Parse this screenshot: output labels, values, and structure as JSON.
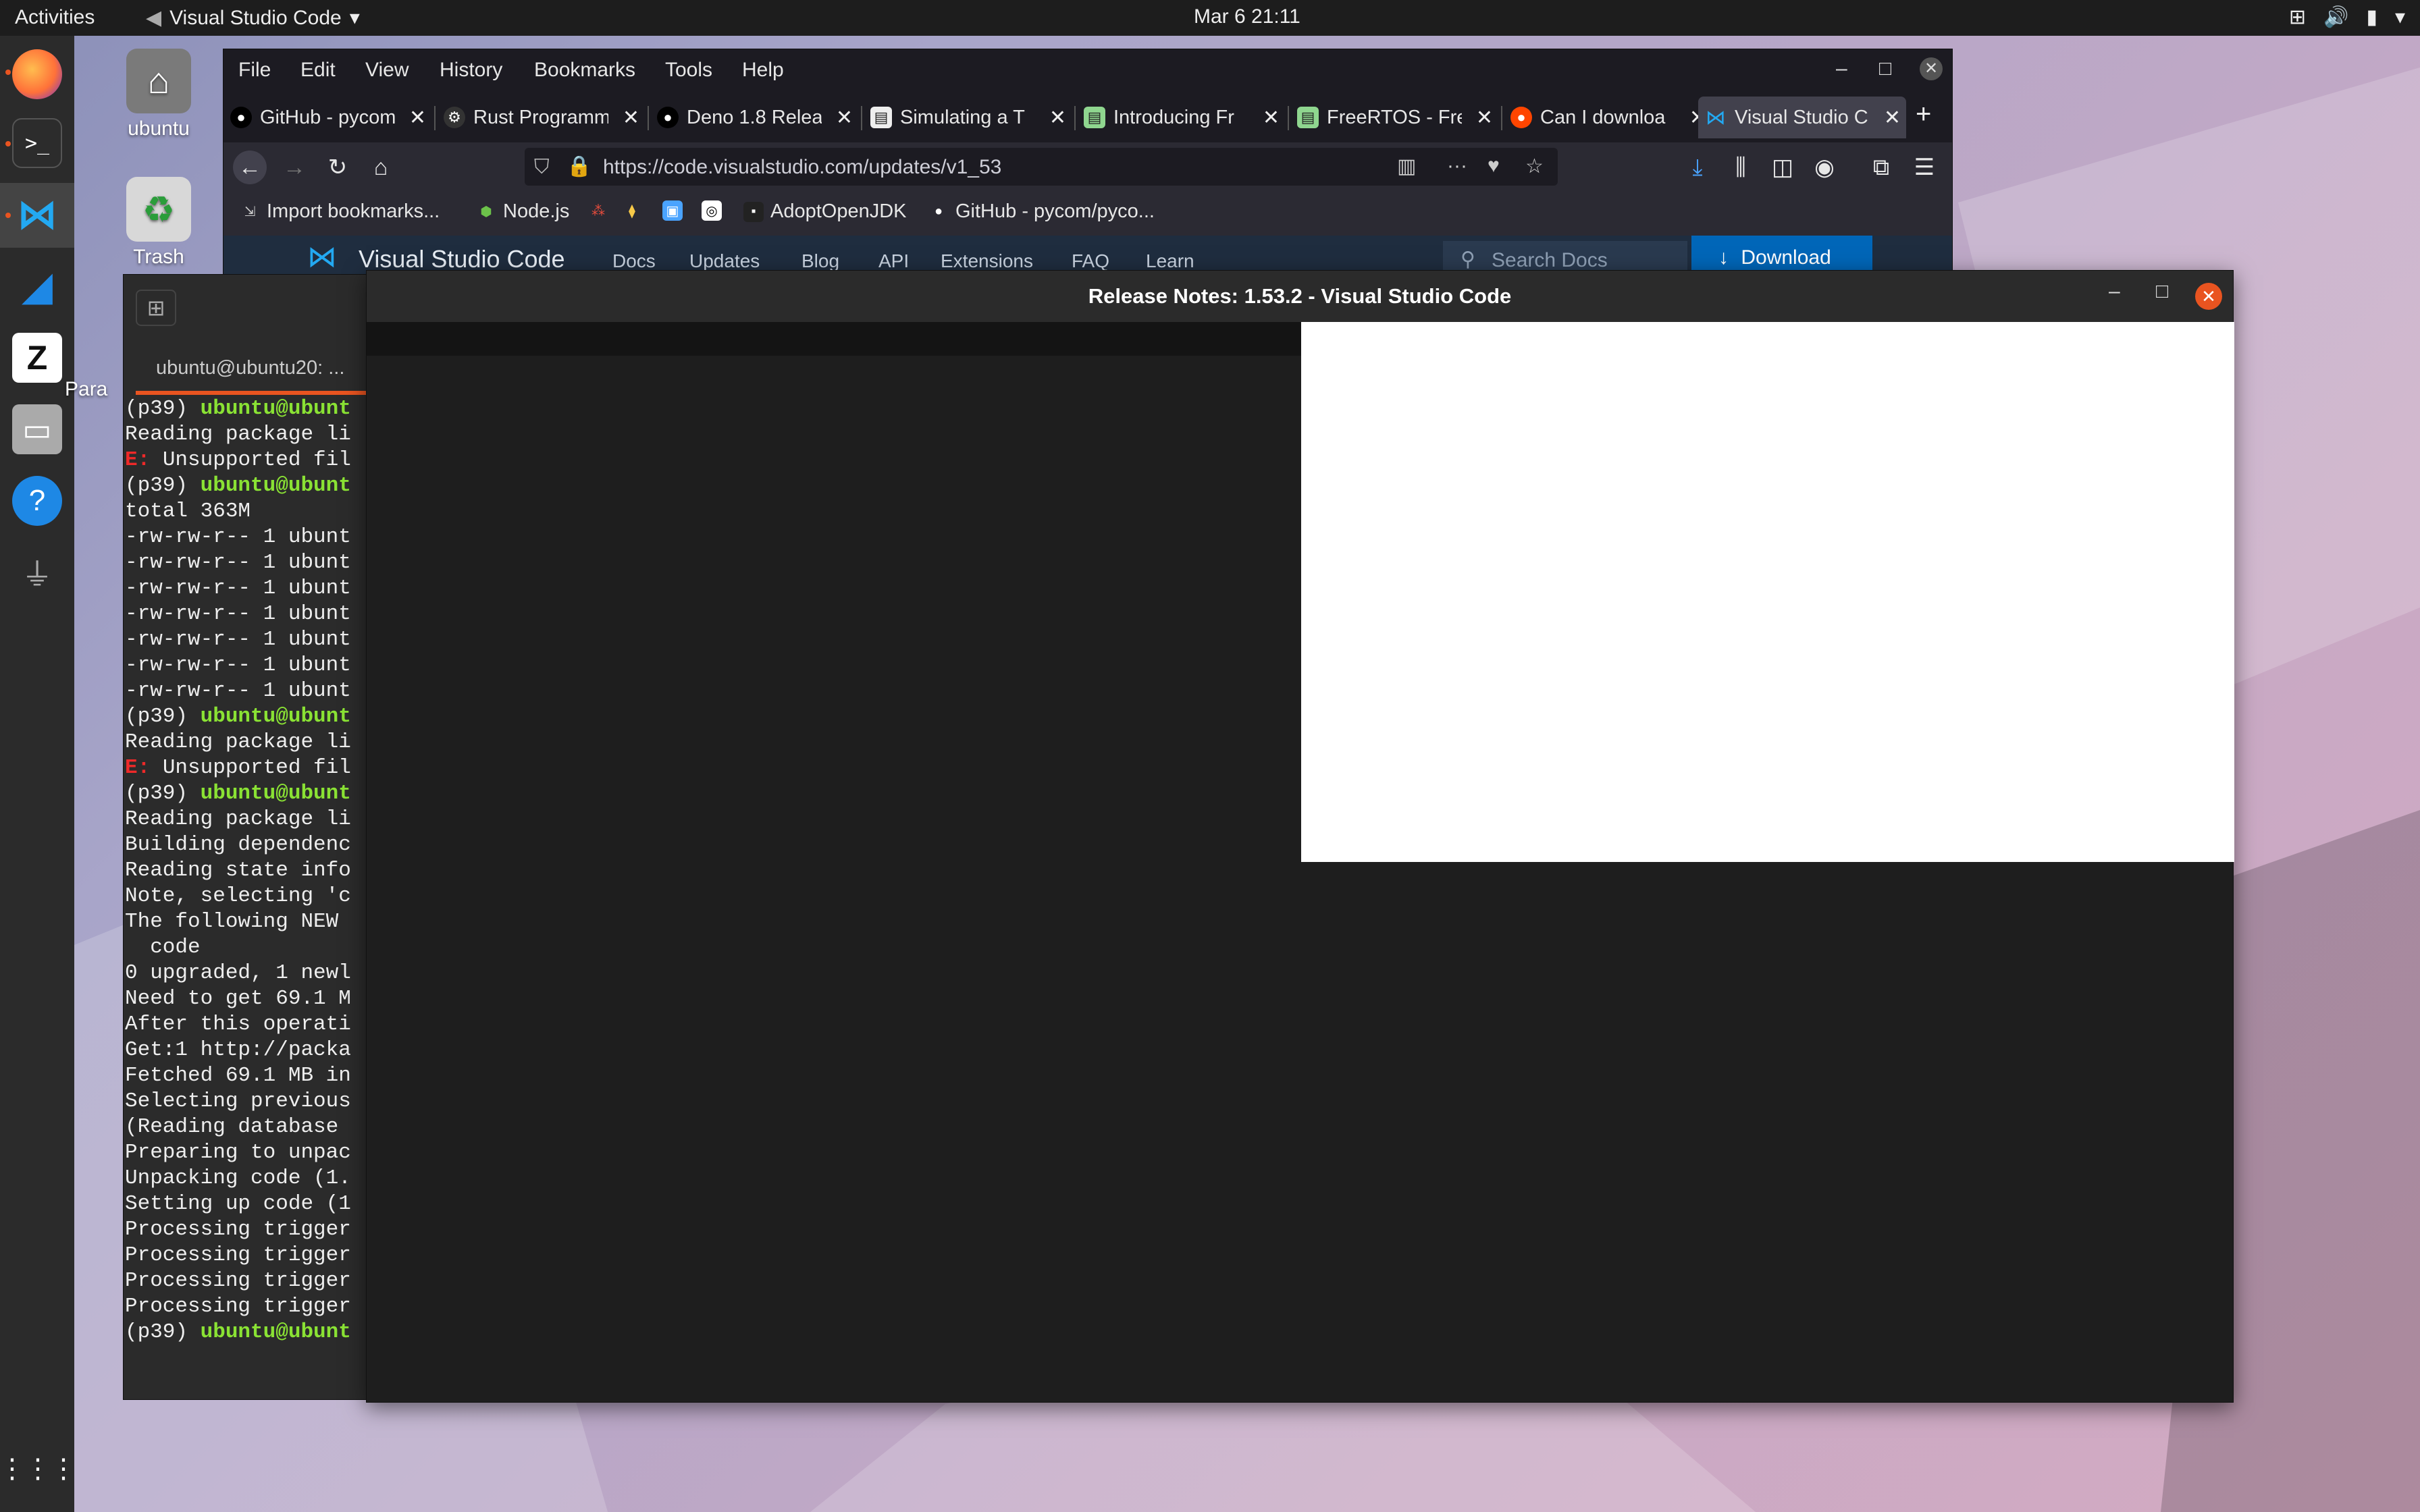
{
  "topbar": {
    "activities": "Activities",
    "app_name": "Visual Studio Code",
    "clock": "Mar 6  21:11"
  },
  "desktop": {
    "home_label": "ubuntu",
    "trash_label": "Trash",
    "partial_label": "Para"
  },
  "firefox": {
    "menu": [
      "File",
      "Edit",
      "View",
      "History",
      "Bookmarks",
      "Tools",
      "Help"
    ],
    "tabs": [
      {
        "label": "GitHub - pycom",
        "icon": "github-icon",
        "color": "#1c1b22"
      },
      {
        "label": "Rust Programm",
        "icon": "rust-icon",
        "color": "#1c1b22"
      },
      {
        "label": "Deno 1.8 Relea",
        "icon": "github-icon",
        "color": "#1c1b22"
      },
      {
        "label": "Simulating a T",
        "icon": "page-icon",
        "color": "#1c1b22"
      },
      {
        "label": "Introducing Fr",
        "icon": "page-icon",
        "color": "#1c1b22"
      },
      {
        "label": "FreeRTOS - Fre",
        "icon": "page-icon",
        "color": "#1c1b22"
      },
      {
        "label": "Can I downloa",
        "icon": "reddit-icon",
        "color": "#1c1b22"
      },
      {
        "label": "Visual Studio C",
        "icon": "vscode-icon",
        "color": "#42414d"
      }
    ],
    "url": "https://code.visualstudio.com/updates/v1_53",
    "bookmarks": [
      {
        "label": "Import bookmarks...",
        "icon": "import-icon"
      },
      {
        "label": "Node.js",
        "icon": "nodejs-icon"
      },
      {
        "label": "",
        "icon": "cluster-icon"
      },
      {
        "label": "",
        "icon": "python-icon"
      },
      {
        "label": "",
        "icon": "bookmark-icon"
      },
      {
        "label": "",
        "icon": "bookmark-icon"
      },
      {
        "label": "AdoptOpenJDK",
        "icon": "adoptopenjdk-icon"
      },
      {
        "label": "GitHub - pycom/pyco...",
        "icon": "github-icon"
      }
    ],
    "site": {
      "brand": "Visual Studio Code",
      "nav": [
        "Docs",
        "Updates",
        "Blog",
        "API",
        "Extensions",
        "FAQ",
        "Learn"
      ],
      "search_placeholder": "Search Docs",
      "download": "Download"
    }
  },
  "terminal": {
    "tab_title": "ubuntu@ubuntu20: ...",
    "lines": [
      {
        "pre": "(p39) ",
        "user": "ubuntu@ubunt",
        "text": ""
      },
      {
        "pre": "",
        "user": "",
        "text": "Reading package li"
      },
      {
        "pre": "",
        "user": "",
        "err": "E:",
        "text": " Unsupported fil"
      },
      {
        "pre": "(p39) ",
        "user": "ubuntu@ubunt",
        "text": ""
      },
      {
        "pre": "",
        "user": "",
        "text": "total 363M"
      },
      {
        "pre": "",
        "user": "",
        "text": "-rw-rw-r-- 1 ubunt"
      },
      {
        "pre": "",
        "user": "",
        "text": "-rw-rw-r-- 1 ubunt"
      },
      {
        "pre": "",
        "user": "",
        "text": "-rw-rw-r-- 1 ubunt"
      },
      {
        "pre": "",
        "user": "",
        "text": "-rw-rw-r-- 1 ubunt"
      },
      {
        "pre": "",
        "user": "",
        "text": "-rw-rw-r-- 1 ubunt"
      },
      {
        "pre": "",
        "user": "",
        "text": "-rw-rw-r-- 1 ubunt"
      },
      {
        "pre": "",
        "user": "",
        "text": "-rw-rw-r-- 1 ubunt"
      },
      {
        "pre": "(p39) ",
        "user": "ubuntu@ubunt",
        "text": ""
      },
      {
        "pre": "",
        "user": "",
        "text": "Reading package li"
      },
      {
        "pre": "",
        "user": "",
        "err": "E:",
        "text": " Unsupported fil"
      },
      {
        "pre": "(p39) ",
        "user": "ubuntu@ubunt",
        "text": ""
      },
      {
        "pre": "",
        "user": "",
        "text": "Reading package li"
      },
      {
        "pre": "",
        "user": "",
        "text": "Building dependenc"
      },
      {
        "pre": "",
        "user": "",
        "text": "Reading state info"
      },
      {
        "pre": "",
        "user": "",
        "text": "Note, selecting 'c"
      },
      {
        "pre": "",
        "user": "",
        "text": "The following NEW"
      },
      {
        "pre": "",
        "user": "",
        "text": "  code"
      },
      {
        "pre": "",
        "user": "",
        "text": "0 upgraded, 1 newl"
      },
      {
        "pre": "",
        "user": "",
        "text": "Need to get 69.1 M"
      },
      {
        "pre": "",
        "user": "",
        "text": "After this operati"
      },
      {
        "pre": "",
        "user": "",
        "text": "Get:1 http://packa"
      },
      {
        "pre": "",
        "user": "",
        "text": "Fetched 69.1 MB in"
      },
      {
        "pre": "",
        "user": "",
        "text": "Selecting previous"
      },
      {
        "pre": "",
        "user": "",
        "text": "(Reading database"
      },
      {
        "pre": "",
        "user": "",
        "text": "Preparing to unpac"
      },
      {
        "pre": "",
        "user": "",
        "text": "Unpacking code (1."
      },
      {
        "pre": "",
        "user": "",
        "text": "Setting up code (1"
      },
      {
        "pre": "",
        "user": "",
        "text": "Processing trigger"
      },
      {
        "pre": "",
        "user": "",
        "text": "Processing trigger"
      },
      {
        "pre": "",
        "user": "",
        "text": "Processing trigger"
      },
      {
        "pre": "",
        "user": "",
        "text": "Processing trigger"
      },
      {
        "pre": "(p39) ",
        "user": "ubuntu@ubunt",
        "text": ""
      }
    ]
  },
  "release_window": {
    "title": "Release Notes: 1.53.2 - Visual Studio Code"
  },
  "colors": {
    "accent": "#e95420",
    "vscode_blue": "#0066b8",
    "prompt_green": "#8ae234",
    "error_red": "#ef2929"
  }
}
